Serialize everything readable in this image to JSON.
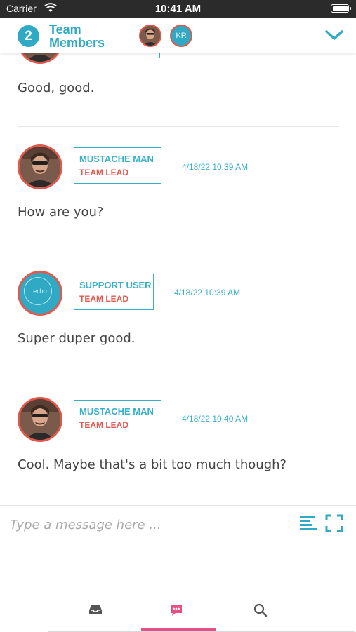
{
  "status_bar": {
    "carrier": "Carrier",
    "time": "10:41 AM",
    "wifi_icon": "wifi-icon",
    "battery_icon": "battery-icon"
  },
  "header": {
    "member_count": "2",
    "title_line1": "Team",
    "title_line2": "Members",
    "avatar_initials": "KR",
    "collapse_icon": "chevron-down-icon"
  },
  "messages": [
    {
      "text": "Good, good."
    },
    {
      "author": "MUSTACHE MAN",
      "role": "TEAM LEAD",
      "timestamp": "4/18/22 10:39 AM",
      "avatar": "photo",
      "text": "How are you?"
    },
    {
      "author": "SUPPORT USER",
      "role": "TEAM LEAD",
      "timestamp": "4/18/22 10:39 AM",
      "avatar": "echo",
      "avatar_label": "echo",
      "text": "Super duper good."
    },
    {
      "author": "MUSTACHE MAN",
      "role": "TEAM LEAD",
      "timestamp": "4/18/22 10:40 AM",
      "avatar": "photo",
      "text": "Cool. Maybe that's a bit too much though?"
    }
  ],
  "composer": {
    "placeholder": "Type a message here ...",
    "align_icon": "align-left-icon",
    "expand_icon": "expand-icon"
  },
  "tabbar": {
    "tabs": [
      {
        "icon": "inbox-icon"
      },
      {
        "icon": "chat-icon",
        "active": true
      },
      {
        "icon": "search-icon"
      }
    ]
  },
  "colors": {
    "accent": "#2fa9c4",
    "role": "#e2584d",
    "active_tab": "#e94f86"
  }
}
